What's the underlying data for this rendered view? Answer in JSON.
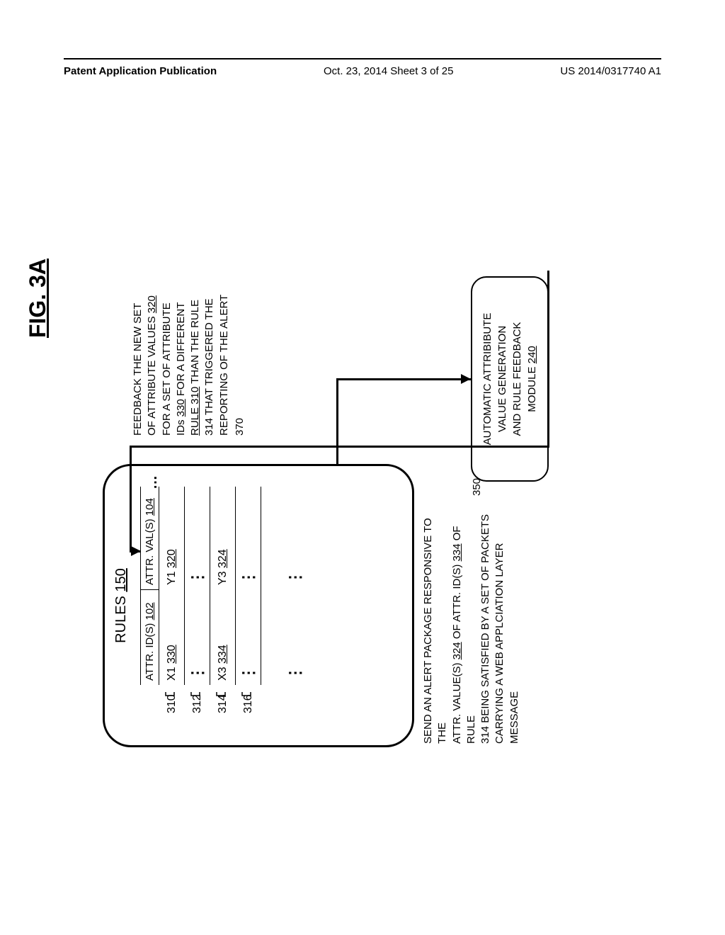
{
  "header": {
    "left": "Patent Application Publication",
    "center": "Oct. 23, 2014  Sheet 3 of 25",
    "right": "US 2014/0317740 A1"
  },
  "figure_label": "FIG. 3A",
  "rules_box": {
    "title_prefix": "RULES ",
    "title_num": "150",
    "col1_header_prefix": "ATTR. ID(S) ",
    "col1_header_num": "102",
    "col2_header_prefix": "ATTR. VAL(S) ",
    "col2_header_num": "104",
    "rows": [
      {
        "label": "310",
        "c1_prefix": "X1 ",
        "c1_num": "330",
        "c2_prefix": "Y1 ",
        "c2_num": "320"
      },
      {
        "label": "312",
        "c1": "⋮",
        "c2": "⋮"
      },
      {
        "label": "314",
        "c1_prefix": "X3 ",
        "c1_num": "334",
        "c2_prefix": "Y3 ",
        "c2_num": "324"
      },
      {
        "label": "316",
        "c1": "⋮",
        "c2": "⋮"
      }
    ],
    "extra_dots_row": {
      "c1": "⋮",
      "c2": "⋮"
    }
  },
  "send_alert": {
    "line1": "SEND AN ALERT PACKAGE RESPONSIVE TO THE",
    "line2a": "ATTR. VALUE(S) ",
    "line2b": "324",
    "line2c": " OF ATTR. ID(S) ",
    "line2d": "334",
    "line2e": " OF RULE",
    "line3": "314 BEING SATISFIED BY A SET OF PACKETS",
    "line4": "CARRYING A WEB APPLCIATION LAYER MESSAGE",
    "ref": "350"
  },
  "feedback": {
    "line1": "FEEDBACK THE NEW SET",
    "line2a": "OF ATTRIBUTE VALUES ",
    "line2b": "320",
    "line3": "FOR A SET OF ATTRIBUTE",
    "line4a": "IDs ",
    "line4b": "330",
    "line4c": " FOR A DIFFERENT",
    "line5a": "RULE ",
    "line5b": "310",
    "line5c": " THAN THE RULE",
    "line6": "314 THAT TRIGGERED THE",
    "line7": "REPORTING OF THE ALERT",
    "ref": "370"
  },
  "module": {
    "line1": "AUTOMATIC ATTRIBIBUTE",
    "line2": "VALUE GENERATION",
    "line3": "AND RULE FEEDBACK",
    "line4_prefix": "MODULE ",
    "line4_num": "240"
  }
}
